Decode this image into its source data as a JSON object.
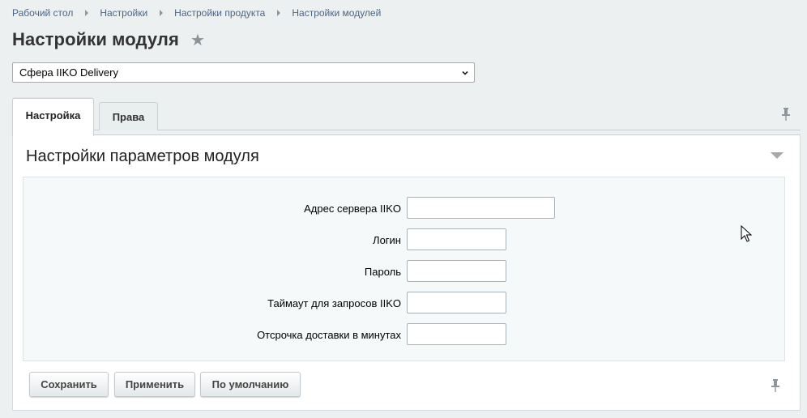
{
  "breadcrumb": [
    "Рабочий стол",
    "Настройки",
    "Настройки продукта",
    "Настройки модулей"
  ],
  "page": {
    "title": "Настройки модуля",
    "module_select": "Сфера IIKO Delivery"
  },
  "tabs": [
    {
      "label": "Настройка",
      "active": true
    },
    {
      "label": "Права",
      "active": false
    }
  ],
  "section": {
    "title": "Настройки параметров модуля",
    "fields": [
      {
        "label": "Адрес сервера IIKO",
        "value": ""
      },
      {
        "label": "Логин",
        "value": ""
      },
      {
        "label": "Пароль",
        "value": ""
      },
      {
        "label": "Таймаут для запросов IIKO",
        "value": ""
      },
      {
        "label": "Отсрочка доставки в минутах",
        "value": ""
      }
    ]
  },
  "buttons": {
    "save": "Сохранить",
    "apply": "Применить",
    "default": "По умолчанию"
  },
  "icons": {
    "favorite": "star-icon",
    "pin": "pin-icon",
    "collapse": "collapse-arrow-icon",
    "select": "chevron-down-icon"
  }
}
